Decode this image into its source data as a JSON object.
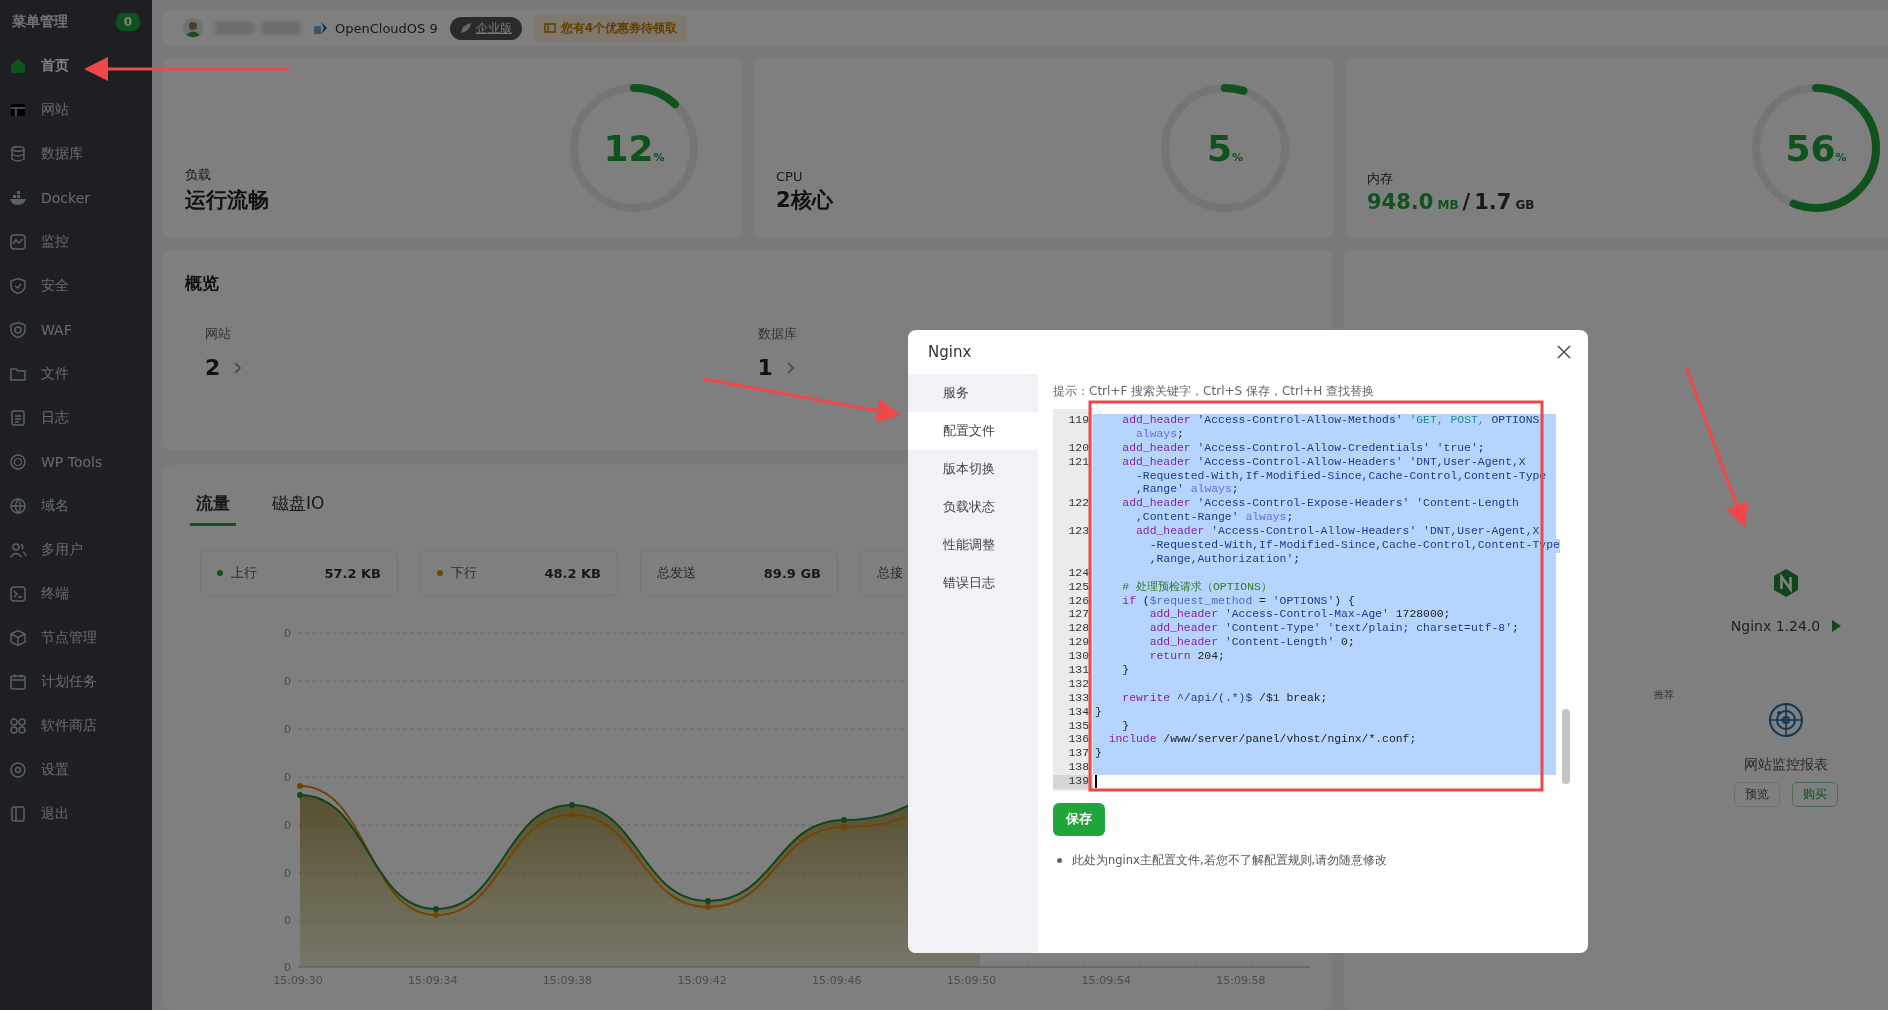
{
  "sidebar": {
    "title": "菜单管理",
    "badge": "0",
    "items": [
      {
        "label": "首页",
        "selected": true
      },
      {
        "label": "网站",
        "selected": false
      },
      {
        "label": "数据库",
        "selected": false
      },
      {
        "label": "Docker",
        "selected": false
      },
      {
        "label": "监控",
        "selected": false
      },
      {
        "label": "安全",
        "selected": false
      },
      {
        "label": "WAF",
        "selected": false
      },
      {
        "label": "文件",
        "selected": false
      },
      {
        "label": "日志",
        "selected": false
      },
      {
        "label": "WP Tools",
        "selected": false
      },
      {
        "label": "域名",
        "selected": false
      },
      {
        "label": "多用户",
        "selected": false
      },
      {
        "label": "终端",
        "selected": false
      },
      {
        "label": "节点管理",
        "selected": false
      },
      {
        "label": "计划任务",
        "selected": false
      },
      {
        "label": "软件商店",
        "selected": false
      },
      {
        "label": "设置",
        "selected": false
      },
      {
        "label": "退出",
        "selected": false
      }
    ]
  },
  "top_bar": {
    "os": "OpenCloudOS 9",
    "edition": "企业版",
    "coupon": "您有4个优惠券待领取"
  },
  "stats": [
    {
      "kind": "text",
      "label": "负载",
      "value": "运行流畅",
      "percent": "12",
      "unit": "%",
      "level": 0.12
    },
    {
      "kind": "text",
      "label": "CPU",
      "value": "2核心",
      "percent": "5",
      "unit": "%",
      "level": 0.05
    },
    {
      "kind": "memory",
      "label": "内存",
      "used": "948.0",
      "used_unit": "MB",
      "separator": "/",
      "total": "1.7",
      "total_unit": "GB",
      "percent": "56",
      "unit": "%",
      "level": 0.56
    }
  ],
  "overview": {
    "title": "概览",
    "items": [
      {
        "label": "网站",
        "count": "2"
      },
      {
        "label": "数据库",
        "count": "1"
      }
    ]
  },
  "traffic": {
    "tabs": [
      {
        "label": "流量",
        "selected": true
      },
      {
        "label": "磁盘IO",
        "selected": false
      }
    ],
    "stats": [
      {
        "label": "上行",
        "value": "57.2 KB",
        "color": "#10521d"
      },
      {
        "label": "下行",
        "value": "48.2 KB",
        "color": "#704500"
      },
      {
        "label": "总发送",
        "value": "89.9 GB"
      },
      {
        "label": "总接"
      }
    ],
    "y_labels": [
      "0",
      "0",
      "0",
      "0",
      "0",
      "0",
      "0",
      "0"
    ],
    "x_labels": [
      "15:09:30",
      "15:09:34",
      "15:09:38",
      "15:09:42",
      "15:09:46",
      "15:09:50",
      "15:09:54",
      "15:09:58"
    ]
  },
  "software": {
    "server": {
      "name": "Nginx 1.24.0"
    },
    "recommend_label": "推荐",
    "recommended": {
      "name": "网站监控报表",
      "buttons": [
        "预览",
        "购买"
      ]
    }
  },
  "dialog": {
    "title": "Nginx",
    "menu": [
      {
        "label": "服务",
        "selected": false
      },
      {
        "label": "配置文件",
        "selected": true
      },
      {
        "label": "版本切换",
        "selected": false
      },
      {
        "label": "负载状态",
        "selected": false
      },
      {
        "label": "性能调整",
        "selected": false
      },
      {
        "label": "错误日志",
        "selected": false
      }
    ],
    "hint": "提示：Ctrl+F 搜索关键字，Ctrl+S 保存，Ctrl+H 查找替换",
    "lines": [
      {
        "number": "119",
        "selected": true,
        "tokens": [
          {
            "kind": "keyword",
            "text": "    add_header"
          },
          {
            "kind": "string",
            "text": " 'Access-Control-Allow-Methods'"
          },
          {
            "kind": "value",
            "text": " 'GET, POST,"
          },
          {
            "kind": "string",
            "text": " OPTIONS'"
          }
        ]
      },
      {
        "selected": true,
        "tokens": [
          {
            "kind": "builtin",
            "text": "      always"
          },
          {
            "kind": "plain",
            "text": ";"
          }
        ]
      },
      {
        "number": "120",
        "selected": true,
        "tokens": [
          {
            "kind": "keyword",
            "text": "    add_header"
          },
          {
            "kind": "string",
            "text": " 'Access-Control-Allow-Credentials' 'true'"
          },
          {
            "kind": "plain",
            "text": ";"
          }
        ]
      },
      {
        "number": "121",
        "selected": true,
        "tokens": [
          {
            "kind": "keyword",
            "text": "    add_header"
          },
          {
            "kind": "string",
            "text": " 'Access-Control-Allow-Headers' 'DNT,User-Agent,X"
          }
        ]
      },
      {
        "selected": true,
        "tokens": [
          {
            "kind": "string",
            "text": "      -Requested-With,If-Modified-Since,Cache-Control,Content-Type"
          }
        ]
      },
      {
        "selected": true,
        "tokens": [
          {
            "kind": "string",
            "text": "      ,Range'"
          },
          {
            "kind": "builtin",
            "text": " always"
          },
          {
            "kind": "plain",
            "text": ";"
          }
        ]
      },
      {
        "number": "122",
        "selected": true,
        "tokens": [
          {
            "kind": "keyword",
            "text": "    add_header"
          },
          {
            "kind": "string",
            "text": " 'Access-Control-Expose-Headers' 'Content-Length"
          }
        ]
      },
      {
        "selected": true,
        "tokens": [
          {
            "kind": "string",
            "text": "      ,Content-Range'"
          },
          {
            "kind": "builtin",
            "text": " always"
          },
          {
            "kind": "plain",
            "text": ";"
          }
        ]
      },
      {
        "number": "123",
        "selected": true,
        "tokens": [
          {
            "kind": "keyword",
            "text": "      add_header"
          },
          {
            "kind": "string",
            "text": " 'Access-Control-Allow-Headers' 'DNT,User-Agent,X"
          }
        ]
      },
      {
        "selected": true,
        "tokens": [
          {
            "kind": "string",
            "text": "        -Requested-With,If-Modified-Since,Cache-Control,Content-Type"
          }
        ]
      },
      {
        "selected": true,
        "tokens": [
          {
            "kind": "string",
            "text": "        ,Range,Authorization'"
          },
          {
            "kind": "plain",
            "text": ";"
          }
        ]
      },
      {
        "number": "124",
        "selected": true
      },
      {
        "number": "125",
        "selected": true,
        "tokens": [
          {
            "kind": "comment",
            "text": "    # 处理预检请求（OPTIONS）"
          }
        ]
      },
      {
        "number": "126",
        "selected": true,
        "tokens": [
          {
            "kind": "keyword",
            "text": "    if"
          },
          {
            "kind": "plain",
            "text": " ("
          },
          {
            "kind": "variable",
            "text": "$request_method"
          },
          {
            "kind": "plain",
            "text": " ="
          },
          {
            "kind": "string",
            "text": " 'OPTIONS'"
          },
          {
            "kind": "plain",
            "text": ") {"
          }
        ]
      },
      {
        "number": "127",
        "selected": true,
        "tokens": [
          {
            "kind": "keyword",
            "text": "        add_header"
          },
          {
            "kind": "string",
            "text": " 'Access-Control-Max-Age'"
          },
          {
            "kind": "plain",
            "text": " 1728000;"
          }
        ]
      },
      {
        "number": "128",
        "selected": true,
        "tokens": [
          {
            "kind": "keyword",
            "text": "        add_header"
          },
          {
            "kind": "string",
            "text": " 'Content-Type' 'text/plain; charset=utf-8'"
          },
          {
            "kind": "plain",
            "text": ";"
          }
        ]
      },
      {
        "number": "129",
        "selected": true,
        "tokens": [
          {
            "kind": "keyword",
            "text": "        add_header"
          },
          {
            "kind": "string",
            "text": " 'Content-Length'"
          },
          {
            "kind": "plain",
            "text": " 0;"
          }
        ]
      },
      {
        "number": "130",
        "selected": true,
        "tokens": [
          {
            "kind": "keyword",
            "text": "        return"
          },
          {
            "kind": "plain",
            "text": " 204;"
          }
        ]
      },
      {
        "number": "131",
        "selected": true,
        "tokens": [
          {
            "kind": "plain",
            "text": "    }"
          }
        ]
      },
      {
        "number": "132",
        "selected": true
      },
      {
        "number": "133",
        "selected": true,
        "tokens": [
          {
            "kind": "keyword",
            "text": "    rewrite"
          },
          {
            "kind": "string",
            "text": " ^/api/(.*)$"
          },
          {
            "kind": "plain",
            "text": " /$1 break;"
          }
        ]
      },
      {
        "number": "134",
        "selected": true,
        "tokens": [
          {
            "kind": "plain",
            "text": "}"
          }
        ]
      },
      {
        "number": "135",
        "selected": true,
        "tokens": [
          {
            "kind": "plain",
            "text": "    }"
          }
        ]
      },
      {
        "number": "136",
        "selected": true,
        "tokens": [
          {
            "kind": "keyword",
            "text": "  include"
          },
          {
            "kind": "plain",
            "text": " /www/server/panel/vhost/nginx/*.conf;"
          }
        ]
      },
      {
        "number": "137",
        "selected": true,
        "tokens": [
          {
            "kind": "plain",
            "text": "}"
          }
        ]
      },
      {
        "number": "138",
        "selected": true
      },
      {
        "number": "139",
        "selected": false,
        "cursor": true
      }
    ],
    "save": "保存",
    "notes": [
      "此处为nginx主配置文件,若您不了解配置规则,请勿随意修改"
    ]
  }
}
